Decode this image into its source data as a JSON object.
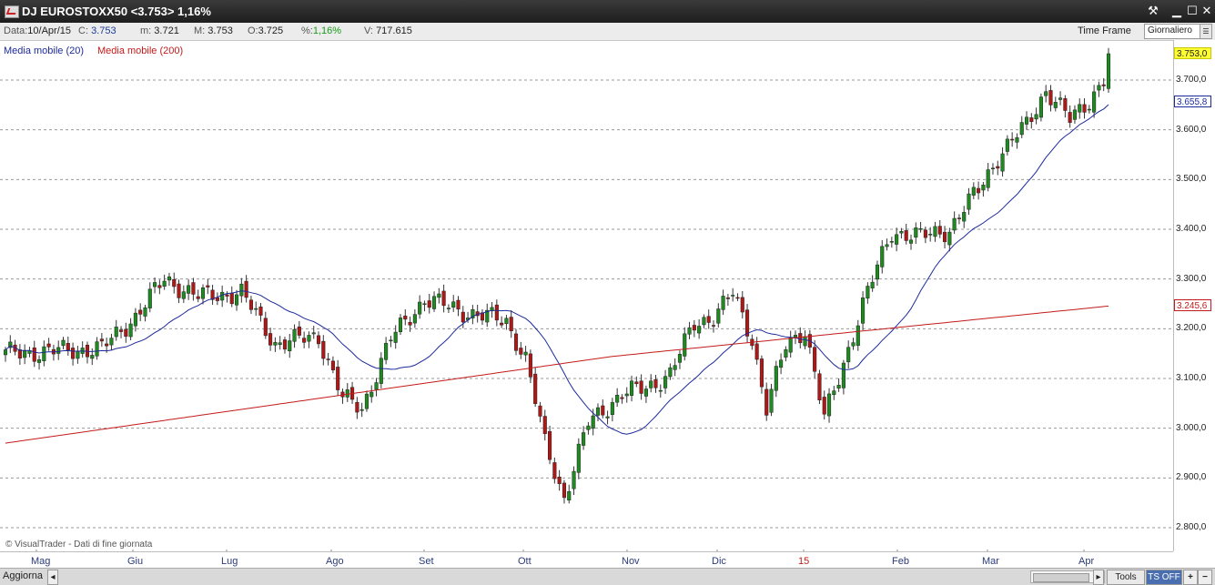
{
  "window": {
    "title": "DJ EUROSTOXX50 <3.753> 1,16%",
    "buttons": [
      "tools-icon",
      "minimize-icon",
      "maximize-icon",
      "close-icon"
    ]
  },
  "info": {
    "data_label": "Data:",
    "data_value": "10/Apr/15",
    "c_label": "C:",
    "c_value": "3.753",
    "m_label": "m:",
    "m_value": "3.721",
    "M_label": "M:",
    "M_value": "3.753",
    "o_label": "O:",
    "o_value": "3.725",
    "pct_label": "%:",
    "pct_value": "1,16%",
    "v_label": "V:",
    "v_value": "717.615",
    "timeframe_label": "Time Frame",
    "timeframe_value": "Giornaliero"
  },
  "legend": {
    "ma20": "Media mobile (20)",
    "ma200": "Media mobile (200)"
  },
  "copyright": "© VisualTrader - Dati di fine giornata",
  "status": {
    "aggiorna": "Aggiorna",
    "tools": "Tools",
    "ts_off": "TS OFF",
    "plus": "+"
  },
  "colors": {
    "up": "#1f8a1f",
    "down": "#b01818",
    "ma20": "#1c2a9c",
    "ma200": "#c41a1a",
    "last_price_bg": "#ffff33"
  },
  "chart_data": {
    "type": "candlestick",
    "x_labels": [
      "Mag",
      "Giu",
      "Lug",
      "Ago",
      "Set",
      "Ott",
      "Nov",
      "Dic",
      "15",
      "Feb",
      "Mar",
      "Apr"
    ],
    "y_ticks": [
      "3.700,0",
      "3.600,0",
      "3.500,0",
      "3.400,0",
      "3.300,0",
      "3.200,0",
      "3.100,0",
      "3.000,0",
      "2.900,0",
      "2.800,0"
    ],
    "y_tick_values": [
      3700,
      3600,
      3500,
      3400,
      3300,
      3200,
      3100,
      3000,
      2900,
      2800
    ],
    "ylim": [
      2775,
      3805
    ],
    "grid": true,
    "grid_style": "dashed horizontal",
    "last_close": "3.753,0",
    "ma20_last": "3.655,8",
    "ma200_last": "3.245,6",
    "close_anchors": [
      [
        0,
        3150
      ],
      [
        20,
        3160
      ],
      [
        27,
        3225
      ],
      [
        33,
        3300
      ],
      [
        40,
        3265
      ],
      [
        49,
        3272
      ],
      [
        56,
        3170
      ],
      [
        65,
        3185
      ],
      [
        70,
        3060
      ],
      [
        74,
        3040
      ],
      [
        80,
        3180
      ],
      [
        87,
        3260
      ],
      [
        95,
        3235
      ],
      [
        104,
        3215
      ],
      [
        108,
        3140
      ],
      [
        112,
        2970
      ],
      [
        116,
        2860
      ],
      [
        121,
        3010
      ],
      [
        128,
        3070
      ],
      [
        133,
        3080
      ],
      [
        138,
        3110
      ],
      [
        143,
        3210
      ],
      [
        147,
        3225
      ],
      [
        151,
        3270
      ],
      [
        155,
        3180
      ],
      [
        158,
        3040
      ],
      [
        162,
        3165
      ],
      [
        166,
        3200
      ],
      [
        170,
        3020
      ],
      [
        173,
        3100
      ],
      [
        178,
        3250
      ],
      [
        184,
        3395
      ],
      [
        190,
        3385
      ],
      [
        196,
        3400
      ],
      [
        202,
        3480
      ],
      [
        206,
        3545
      ],
      [
        212,
        3610
      ],
      [
        216,
        3680
      ],
      [
        221,
        3620
      ],
      [
        225,
        3660
      ],
      [
        228,
        3700
      ],
      [
        229,
        3753
      ]
    ],
    "ma200_start": 2970,
    "ma200_end": 3245.6,
    "series": [
      {
        "name": "Media mobile (20)",
        "window": 20
      },
      {
        "name": "Media mobile (200)",
        "window": 200
      }
    ]
  }
}
